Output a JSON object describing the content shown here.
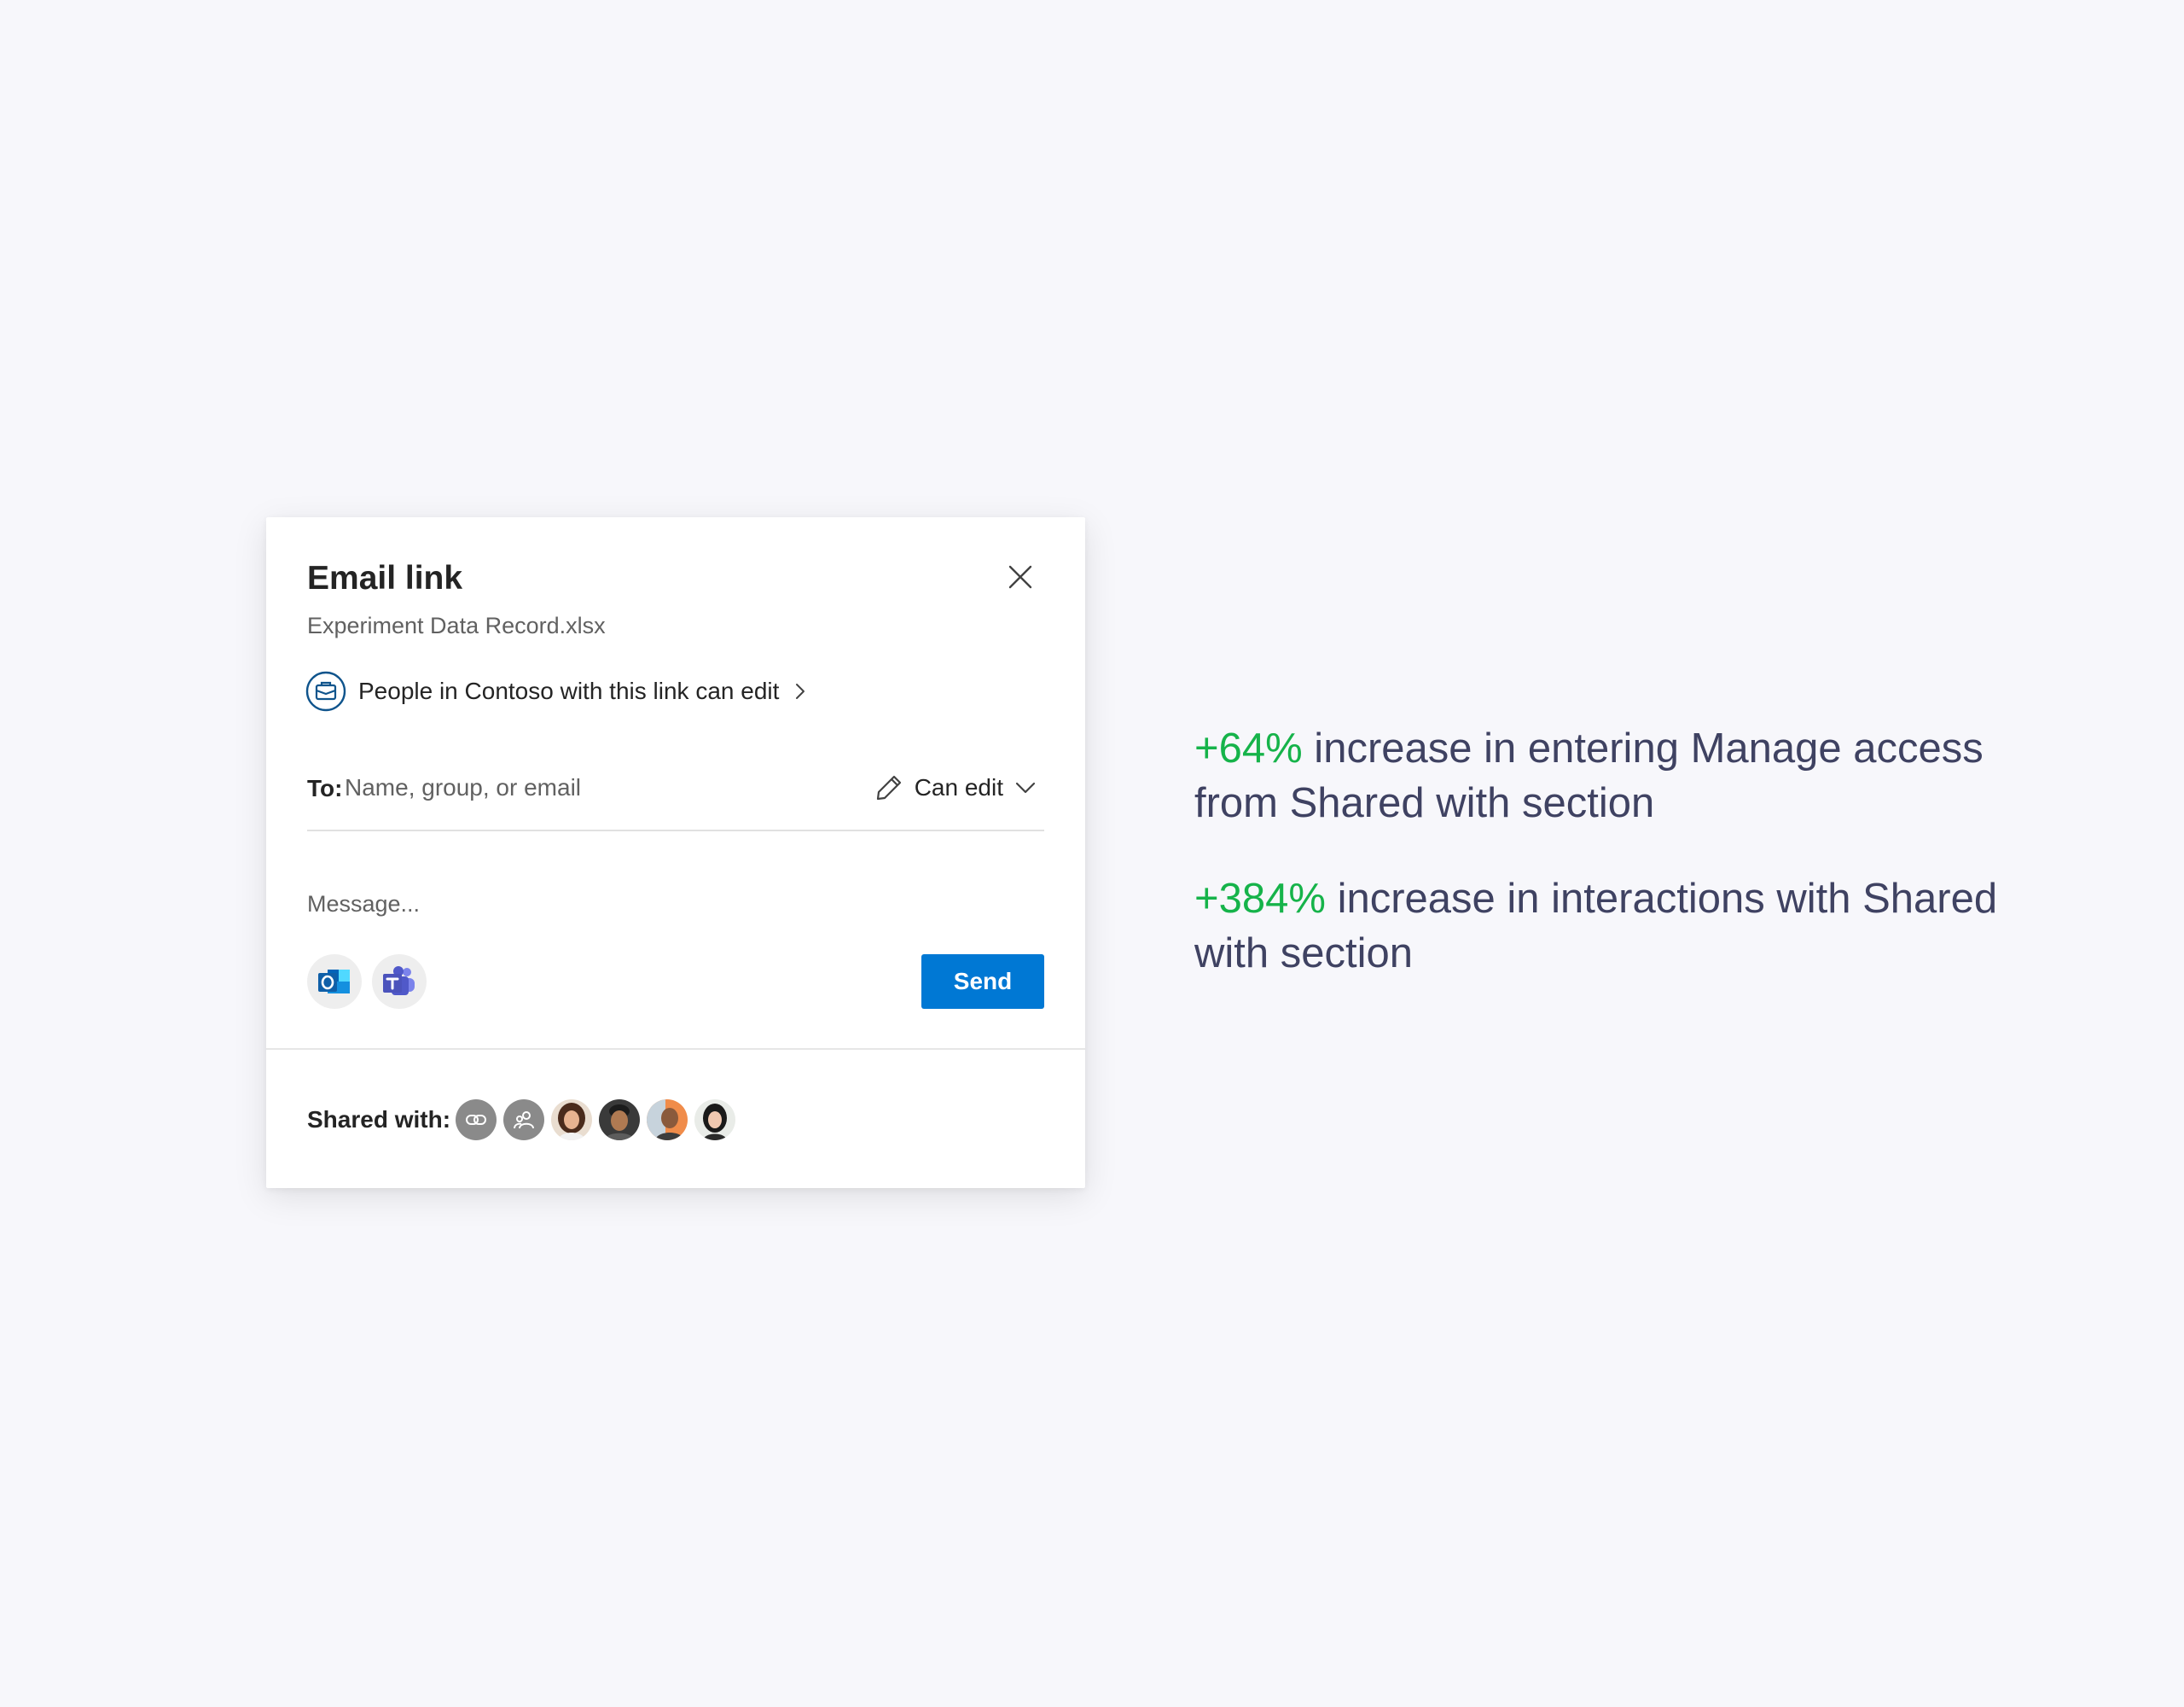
{
  "dialog": {
    "title": "Email link",
    "filename": "Experiment Data Record.xlsx",
    "permission_text": "People in Contoso with this link can edit",
    "to_label": "To:",
    "to_placeholder": "Name, group, or email",
    "permission_dropdown_label": "Can edit",
    "message_placeholder": "Message...",
    "send_label": "Send",
    "share_apps": [
      "outlook-icon",
      "teams-icon"
    ],
    "shared_with_label": "Shared with:",
    "shared_with": [
      {
        "type": "link-icon"
      },
      {
        "type": "people-icon"
      },
      {
        "type": "avatar"
      },
      {
        "type": "avatar"
      },
      {
        "type": "avatar"
      },
      {
        "type": "avatar"
      }
    ]
  },
  "stats": [
    {
      "value": "+64%",
      "text": " increase in entering Manage access from Shared with section"
    },
    {
      "value": "+384%",
      "text": " increase in interactions with Shared with section"
    }
  ],
  "colors": {
    "accent": "#0078d4",
    "highlight": "#16b34a",
    "stat_text": "#3f4262",
    "background": "#f7f7fb"
  }
}
